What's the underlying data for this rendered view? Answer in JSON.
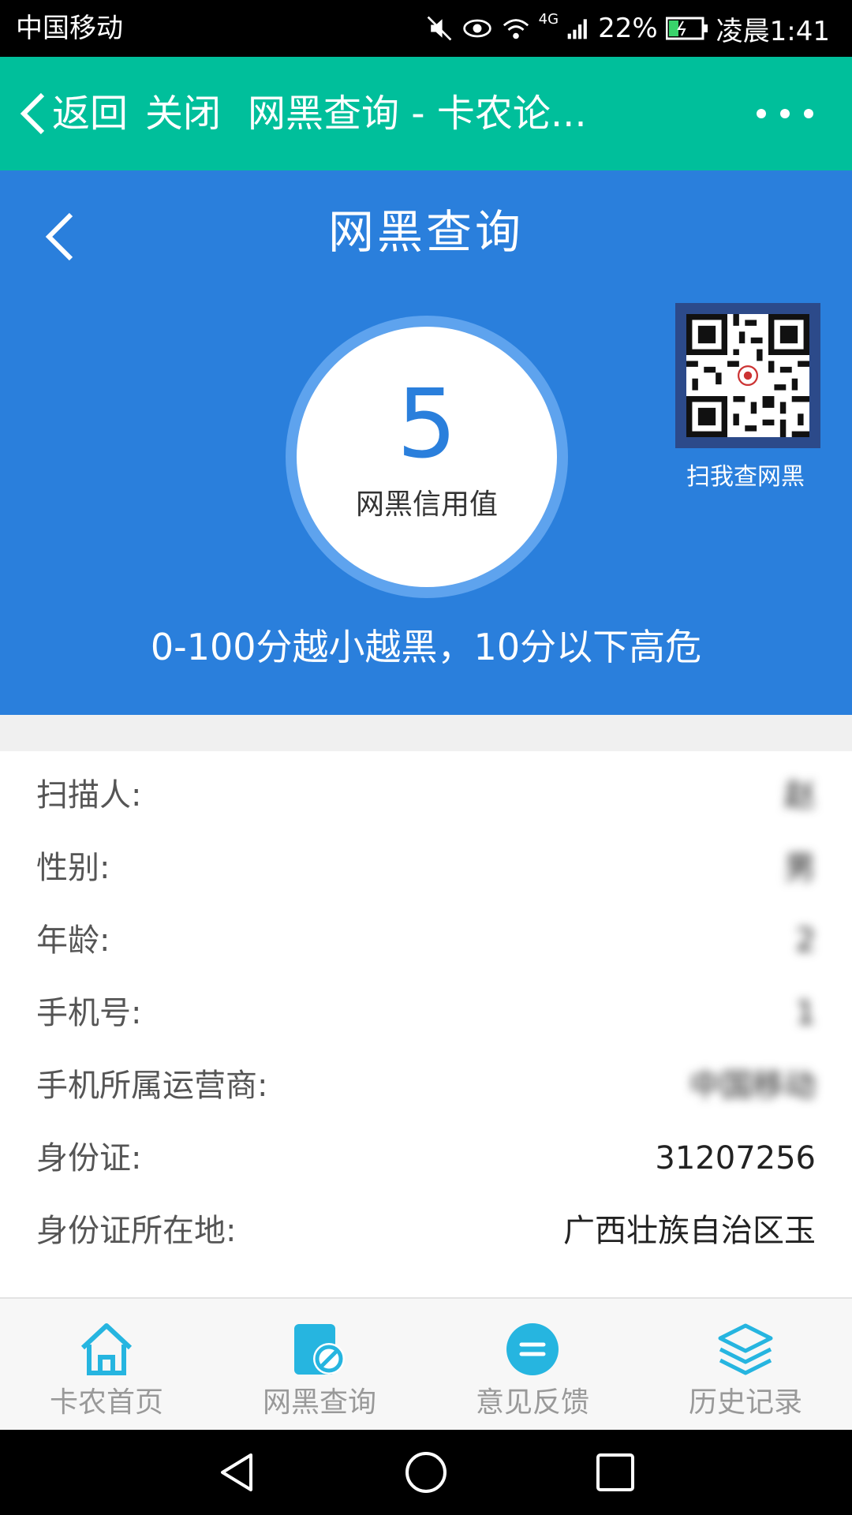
{
  "status_bar": {
    "carrier": "中国移动",
    "network": "4G",
    "battery": "22%",
    "time": "凌晨1:41"
  },
  "wx_bar": {
    "back_label": "返回",
    "close_label": "关闭",
    "title": "网黑查询 - 卡农论..."
  },
  "hero": {
    "title": "网黑查询",
    "score": "5",
    "score_label": "网黑信用值",
    "qr_label": "扫我查网黑",
    "note": "0-100分越小越黑，10分以下高危"
  },
  "info": {
    "rows": [
      {
        "label": "扫描人:",
        "value": "赵"
      },
      {
        "label": "性别:",
        "value": "男"
      },
      {
        "label": "年龄:",
        "value": "2"
      },
      {
        "label": "手机号:",
        "value": "1"
      },
      {
        "label": "手机所属运营商:",
        "value": "中国移动"
      },
      {
        "label": "身份证:",
        "value": "31207256"
      },
      {
        "label": "身份证所在地:",
        "value": "广西壮族自治区玉"
      }
    ]
  },
  "tabs": [
    {
      "label": "卡农首页",
      "icon": "home-icon"
    },
    {
      "label": "网黑查询",
      "icon": "blacklist-search-icon"
    },
    {
      "label": "意见反馈",
      "icon": "feedback-icon"
    },
    {
      "label": "历史记录",
      "icon": "layers-icon"
    }
  ],
  "colors": {
    "wx_bar": "#00bf9b",
    "hero": "#2a7fdc",
    "tab_icon": "#26b5e0"
  }
}
